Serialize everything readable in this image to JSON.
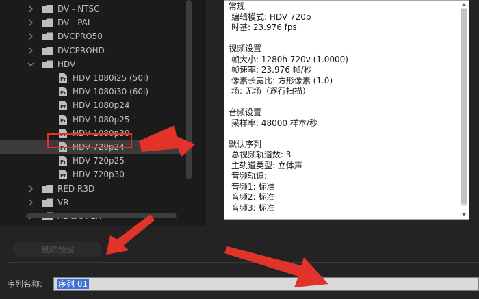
{
  "tree": {
    "items": [
      {
        "label": "DV - NTSC",
        "kind": "folder",
        "expanded": false
      },
      {
        "label": "DV - PAL",
        "kind": "folder",
        "expanded": false
      },
      {
        "label": "DVCPRO50",
        "kind": "folder",
        "expanded": false
      },
      {
        "label": "DVCPROHD",
        "kind": "folder",
        "expanded": false
      },
      {
        "label": "HDV",
        "kind": "folder",
        "expanded": true
      },
      {
        "label": "HDV 1080i25 (50i)",
        "kind": "preset"
      },
      {
        "label": "HDV 1080i30 (60i)",
        "kind": "preset"
      },
      {
        "label": "HDV 1080p24",
        "kind": "preset"
      },
      {
        "label": "HDV 1080p25",
        "kind": "preset"
      },
      {
        "label": "HDV 1080p30",
        "kind": "preset"
      },
      {
        "label": "HDV 720p24",
        "kind": "preset",
        "selected": true
      },
      {
        "label": "HDV 720p25",
        "kind": "preset"
      },
      {
        "label": "HDV 720p30",
        "kind": "preset"
      },
      {
        "label": "RED R3D",
        "kind": "folder",
        "expanded": false
      },
      {
        "label": "VR",
        "kind": "folder",
        "expanded": false
      },
      {
        "label": "XDCAM EX",
        "kind": "folder",
        "expanded": false
      }
    ]
  },
  "description": {
    "lines": [
      "常规",
      "编辑模式: HDV 720p",
      "时基: 23.976 fps",
      "",
      "视频设置",
      "帧大小: 1280h 720v (1.0000)",
      "帧速率: 23.976  帧/秒",
      "像素长宽比: 方形像素 (1.0)",
      "场: 无场（逐行扫描）",
      "",
      "音频设置",
      "采样率: 48000 样本/秒",
      "",
      "默认序列",
      "总视频轨道数: 3",
      "主轨道类型: 立体声",
      "音频轨道:",
      "音频1: 标准",
      "音频2: 标准",
      "音频3: 标准"
    ]
  },
  "delete_button": {
    "label": "删除预设"
  },
  "sequence_name": {
    "label": "序列名称:",
    "value": "序列 01"
  },
  "colors": {
    "annotation_red": "#e2332b",
    "selection_blue": "#3b6fd6"
  }
}
